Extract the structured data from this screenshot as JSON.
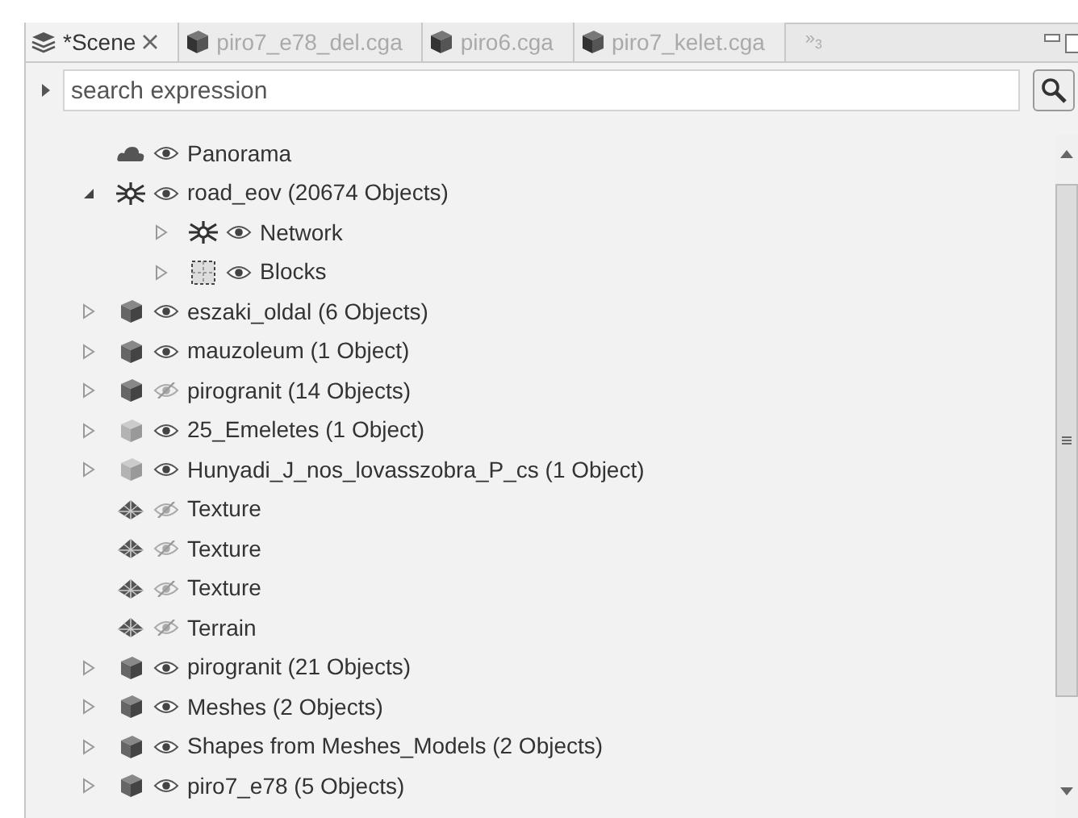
{
  "tabs": [
    {
      "label": "*Scene",
      "selected": true,
      "kind": "scene",
      "closable": true
    },
    {
      "label": "piro7_e78_del.cga",
      "selected": false,
      "kind": "rule"
    },
    {
      "label": "piro6.cga",
      "selected": false,
      "kind": "rule"
    },
    {
      "label": "piro7_kelet.cga",
      "selected": false,
      "kind": "rule"
    }
  ],
  "tab_overflow": {
    "symbol": "»",
    "count": "3"
  },
  "search": {
    "placeholder": "search expression"
  },
  "tree": [
    {
      "label": "Panorama",
      "kind": "cloud",
      "visible": true
    },
    {
      "label": "road_eov (20674 Objects)",
      "kind": "network",
      "visible": true,
      "expanded": true,
      "children": [
        {
          "label": "Network",
          "kind": "network",
          "visible": true,
          "expanded": false
        },
        {
          "label": "Blocks",
          "kind": "blocks",
          "visible": true,
          "expanded": false
        }
      ]
    },
    {
      "label": "eszaki_oldal (6 Objects)",
      "kind": "model",
      "visible": true,
      "expanded": false
    },
    {
      "label": "mauzoleum (1 Object)",
      "kind": "model",
      "visible": true,
      "expanded": false
    },
    {
      "label": "pirogranit (14 Objects)",
      "kind": "model",
      "visible": false,
      "expanded": false
    },
    {
      "label": "25_Emeletes (1 Object)",
      "kind": "model-light",
      "visible": true,
      "expanded": false
    },
    {
      "label": "Hunyadi_J_nos_lovasszobra_P_cs (1 Object)",
      "kind": "model-light",
      "visible": true,
      "expanded": false
    },
    {
      "label": "Texture",
      "kind": "texture",
      "visible": false
    },
    {
      "label": "Texture",
      "kind": "texture",
      "visible": false
    },
    {
      "label": "Texture",
      "kind": "texture",
      "visible": false
    },
    {
      "label": "Terrain",
      "kind": "texture",
      "visible": false
    },
    {
      "label": "pirogranit (21 Objects)",
      "kind": "model",
      "visible": true,
      "expanded": false
    },
    {
      "label": "Meshes (2 Objects)",
      "kind": "model",
      "visible": true,
      "expanded": false
    },
    {
      "label": "Shapes from Meshes_Models (2 Objects)",
      "kind": "model",
      "visible": true,
      "expanded": false
    },
    {
      "label": "piro7_e78 (5 Objects)",
      "kind": "model",
      "visible": true,
      "expanded": false
    }
  ]
}
